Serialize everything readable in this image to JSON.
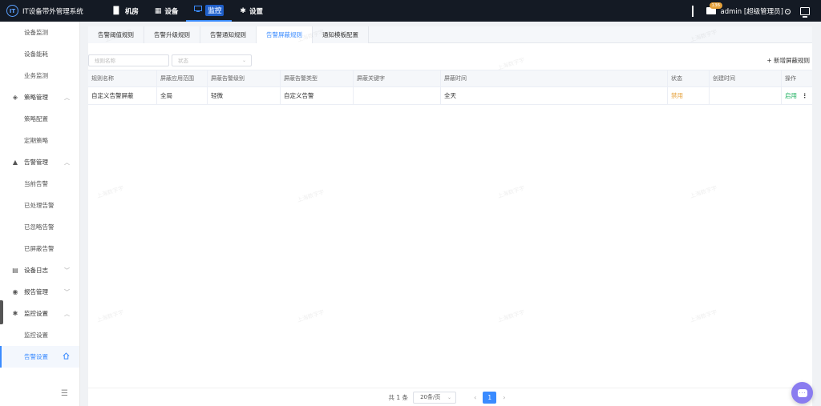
{
  "app": {
    "title": "IT设备带外管理系统",
    "logo_text": "IT"
  },
  "topnav": [
    {
      "icon": "chart-bar-icon",
      "glyph": "▐▌",
      "label": "机房",
      "active": false
    },
    {
      "icon": "grid-icon",
      "glyph": "▦",
      "label": "设备",
      "active": false
    },
    {
      "icon": "monitor-icon",
      "glyph": "",
      "label": "监控",
      "active": true
    },
    {
      "icon": "gear-icon",
      "glyph": "✱",
      "label": "设置",
      "active": false
    }
  ],
  "user": {
    "badge": "136",
    "name": "admin [超级管理员]"
  },
  "sidebar": {
    "items": [
      {
        "type": "item",
        "label": "设备监测"
      },
      {
        "type": "item",
        "label": "设备能耗"
      },
      {
        "type": "item",
        "label": "业务监测"
      },
      {
        "type": "group",
        "label": "策略管理",
        "icon": "shield-icon",
        "glyph": "◈",
        "open": true
      },
      {
        "type": "item",
        "label": "策略配置"
      },
      {
        "type": "item",
        "label": "定期策略"
      },
      {
        "type": "group",
        "label": "告警管理",
        "icon": "bell-icon",
        "glyph": "▲",
        "open": true
      },
      {
        "type": "item",
        "label": "当前告警"
      },
      {
        "type": "item",
        "label": "已处理告警"
      },
      {
        "type": "item",
        "label": "已忽略告警"
      },
      {
        "type": "item",
        "label": "已屏蔽告警"
      },
      {
        "type": "group",
        "label": "设备日志",
        "icon": "log-icon",
        "glyph": "▤",
        "open": false
      },
      {
        "type": "group",
        "label": "报告管理",
        "icon": "report-icon",
        "glyph": "◉",
        "open": false
      },
      {
        "type": "group",
        "label": "监控设置",
        "icon": "settings-icon",
        "glyph": "✱",
        "open": true
      },
      {
        "type": "item",
        "label": "监控设置"
      },
      {
        "type": "item",
        "label": "告警设置",
        "active": true
      }
    ]
  },
  "tabs": [
    {
      "label": "告警阈值规则",
      "active": false
    },
    {
      "label": "告警升级规则",
      "active": false
    },
    {
      "label": "告警通知规则",
      "active": false
    },
    {
      "label": "告警屏蔽规则",
      "active": true
    },
    {
      "label": "通知模板配置",
      "active": false
    }
  ],
  "filters": {
    "name_placeholder": "规则名称",
    "status_placeholder": "状态",
    "add_label": "+ 新增屏蔽规则"
  },
  "table": {
    "headers": [
      "规则名称",
      "屏蔽应用范围",
      "屏蔽告警级别",
      "屏蔽告警类型",
      "屏蔽关键字",
      "屏蔽时间",
      "状态",
      "创建时间",
      "操作"
    ],
    "rows": [
      {
        "name": "自定义告警屏蔽",
        "scope": "全局",
        "level": "轻微",
        "type": "自定义告警",
        "keyword": "",
        "time": "全天",
        "status": "禁用",
        "created": "",
        "action": "启用"
      }
    ]
  },
  "watermark": "上海数字宇",
  "pagination": {
    "total": "共 1 条",
    "page_size": "20条/页",
    "current": "1"
  },
  "colors": {
    "accent": "#3a8bff",
    "topbar": "#141a24",
    "status_disabled": "#e6a23c",
    "action_enable": "#1aaf5d"
  }
}
